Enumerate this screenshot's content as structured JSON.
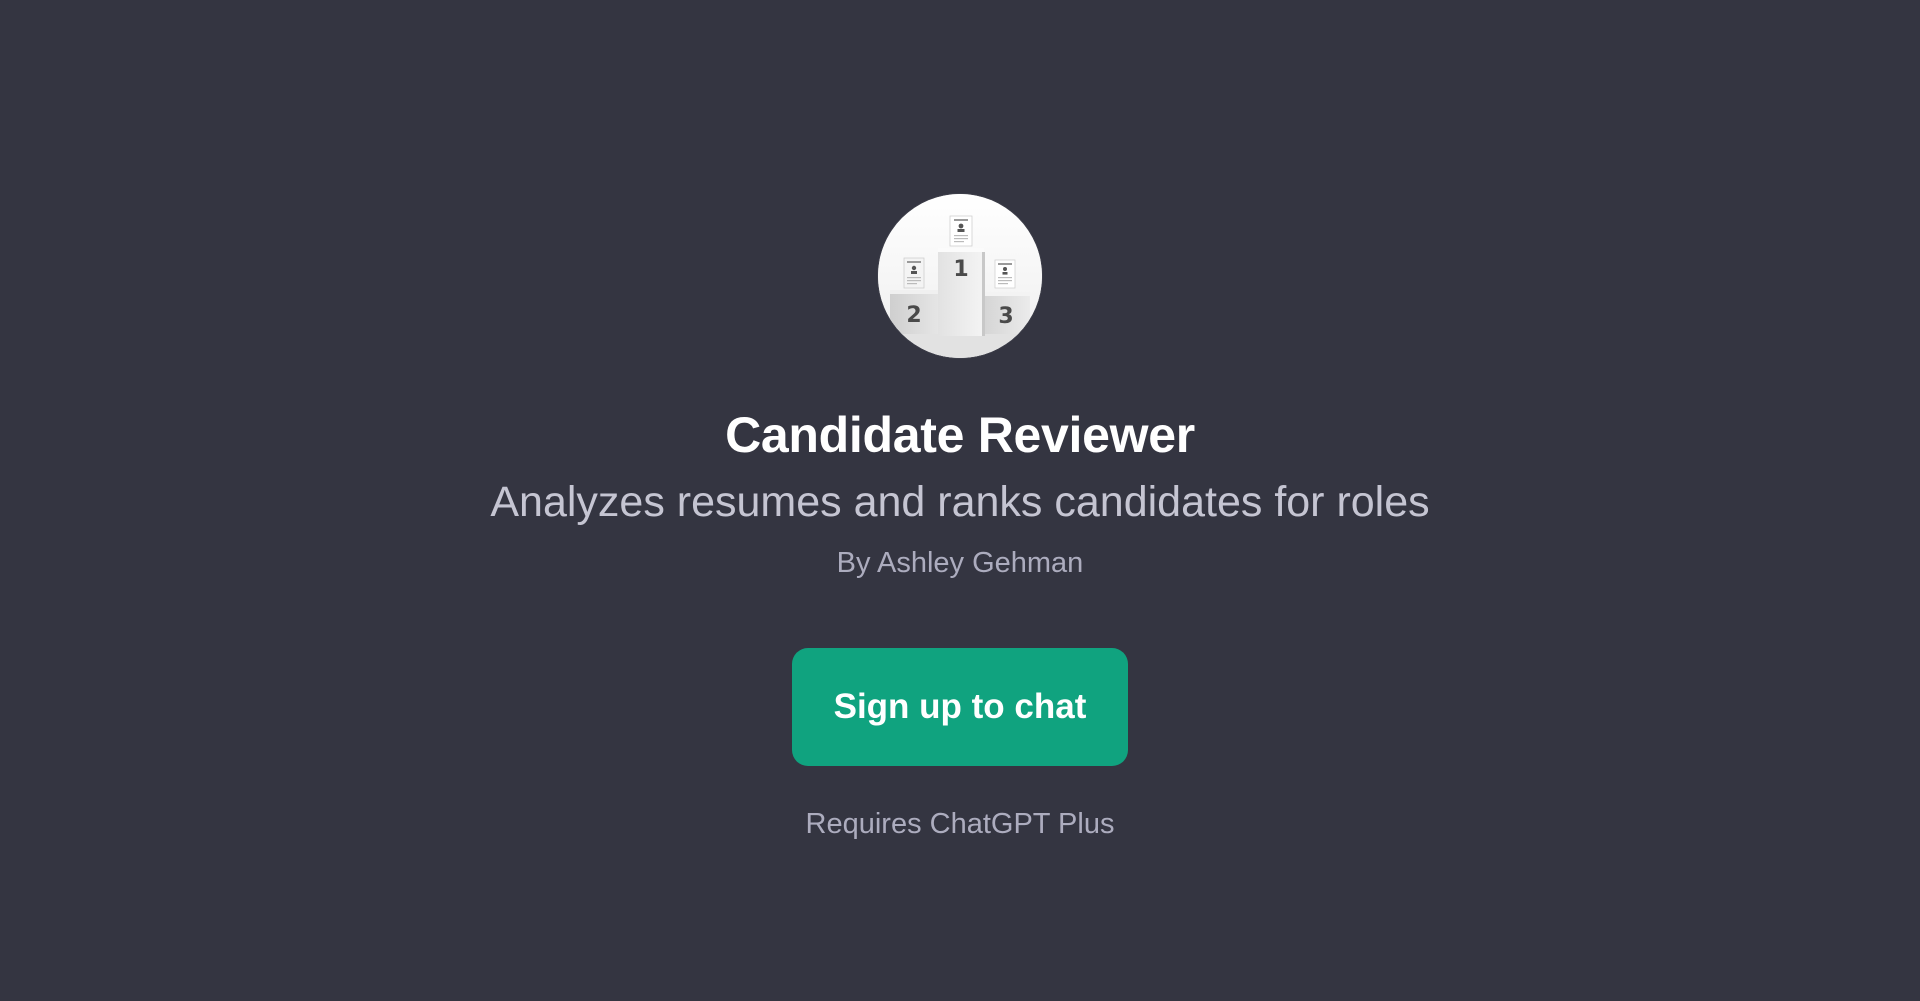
{
  "app": {
    "background_color": "#343541",
    "accent_color": "#10a37f"
  },
  "gpt": {
    "avatar_icon": "podium-resumes-icon",
    "podium_labels": [
      "2",
      "1",
      "3"
    ],
    "title": "Candidate Reviewer",
    "description": "Analyzes resumes and ranks candidates for roles",
    "author": "By Ashley Gehman"
  },
  "actions": {
    "signup_label": "Sign up to chat",
    "requirement_note": "Requires ChatGPT Plus"
  }
}
